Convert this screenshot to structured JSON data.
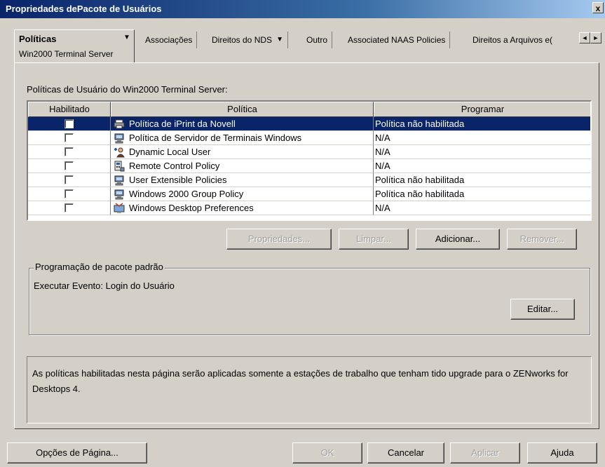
{
  "window": {
    "title": "Propriedades dePacote de Usuários",
    "close_glyph": "x"
  },
  "tabs": {
    "active": {
      "label": "Políticas",
      "sub_label": "Win2000 Terminal Server"
    },
    "others": [
      {
        "label": "Associações"
      },
      {
        "label": "Direitos do NDS"
      },
      {
        "label": "Outro"
      },
      {
        "label": "Associated NAAS Policies"
      },
      {
        "label": "Direitos a Arquivos e("
      }
    ],
    "dropdown_glyph": "▼",
    "scroll_left": "◄",
    "scroll_right": "►"
  },
  "section": {
    "title": "Políticas de Usuário do Win2000 Terminal Server:"
  },
  "table": {
    "columns": [
      "Habilitado",
      "Política",
      "Programar"
    ],
    "rows": [
      {
        "policy": "Política de iPrint da Novell",
        "schedule": "Política não habilitada",
        "icon": "printer-icon",
        "selected": true
      },
      {
        "policy": "Política de Servidor de Terminais Windows",
        "schedule": "N/A",
        "icon": "computer-icon",
        "selected": false
      },
      {
        "policy": "Dynamic Local User",
        "schedule": "N/A",
        "icon": "add-user-icon",
        "selected": false
      },
      {
        "policy": "Remote Control Policy",
        "schedule": "N/A",
        "icon": "remote-control-icon",
        "selected": false
      },
      {
        "policy": "User Extensible Policies",
        "schedule": "Política não habilitada",
        "icon": "computer-icon",
        "selected": false
      },
      {
        "policy": "Windows 2000 Group Policy",
        "schedule": "Política não habilitada",
        "icon": "computer-icon",
        "selected": false
      },
      {
        "policy": "Windows Desktop Preferences",
        "schedule": "N/A",
        "icon": "desktop-icon",
        "selected": false
      }
    ]
  },
  "table_buttons": {
    "properties": "Propriedades...",
    "clear": "Limpar...",
    "add": "Adicionar...",
    "remove": "Remover..."
  },
  "schedule_group": {
    "legend": "Programação de pacote padrão",
    "text": "Executar Evento: Login do Usuário",
    "edit_button": "Editar..."
  },
  "note": {
    "text": "As políticas habilitadas nesta página serão aplicadas somente a estações de trabalho que tenham tido upgrade para o ZENworks for Desktops 4."
  },
  "footer_buttons": {
    "page_options": "Opções de Página...",
    "ok": "OK",
    "cancel": "Cancelar",
    "apply": "Aplicar",
    "help": "Ajuda"
  },
  "colors": {
    "selection": "#0a246a",
    "face": "#d4d0c8",
    "title_gradient_start": "#0a246a"
  }
}
